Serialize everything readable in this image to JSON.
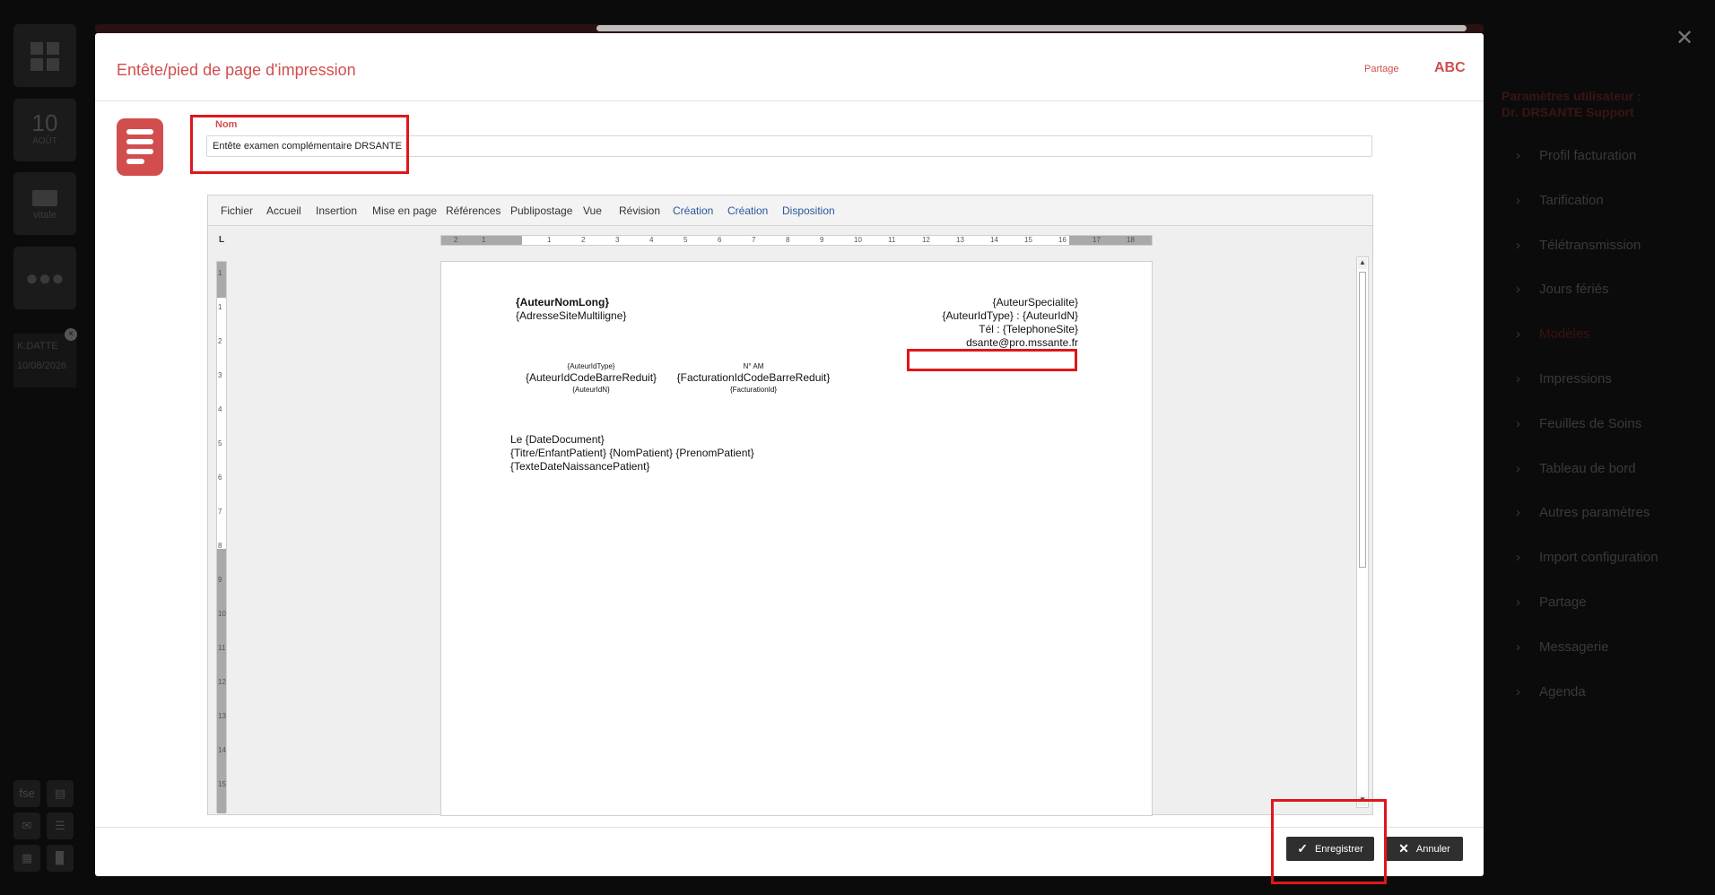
{
  "modal": {
    "title": "Entête/pied de page d'impression",
    "partage": "Partage",
    "abc": "ABC",
    "name_label": "Nom",
    "name_value": "Entête examen complémentaire DRSANTE"
  },
  "ribbon": {
    "tabs": [
      "Fichier",
      "Accueil",
      "Insertion",
      "Mise en page",
      "Références",
      "Publipostage",
      "Vue",
      "Révision",
      "Création",
      "Création",
      "Disposition"
    ]
  },
  "ruler": {
    "corner": "L",
    "h_labels": [
      "2",
      "1",
      "1",
      "2",
      "3",
      "4",
      "5",
      "6",
      "7",
      "8",
      "9",
      "10",
      "11",
      "12",
      "13",
      "14",
      "15",
      "16",
      "17",
      "18"
    ],
    "v_labels": [
      "1",
      "1",
      "2",
      "3",
      "4",
      "5",
      "6",
      "7",
      "8",
      "9",
      "10",
      "11",
      "12",
      "13",
      "14",
      "15"
    ]
  },
  "document": {
    "author_name": "{AuteurNomLong}",
    "address": "{AdresseSiteMultiligne}",
    "specialty": "{AuteurSpecialite}",
    "id_line": "{AuteurIdType} : {AuteurIdN}",
    "tel": "Tél : {TelephoneSite}",
    "email": "dsante@pro.mssante.fr",
    "barcode1_top": "{AuteurIdType}",
    "barcode1_main": "{AuteurIdCodeBarreReduit}",
    "barcode1_bottom": "{AuteurIdN}",
    "barcode2_top": "N° AM",
    "barcode2_main": "{FacturationIdCodeBarreReduit}",
    "barcode2_bottom": "{FacturationId}",
    "date_line": "Le {DateDocument}",
    "patient_line": "{Titre/EnfantPatient} {NomPatient} {PrenomPatient}",
    "birth_line": "{TexteDateNaissancePatient}"
  },
  "buttons": {
    "save": "Enregistrer",
    "cancel": "Annuler"
  },
  "left_rail": {
    "day": "10",
    "month": "AOÛT",
    "vitale": "vitale",
    "patient_name": "K.DATTE",
    "patient_date": "10/08/2026",
    "fse": "fse"
  },
  "right_panel": {
    "title": "Paramètres utilisateur :",
    "subtitle": "Dr. DRSANTE Support",
    "items": [
      "Profil facturation",
      "Tarification",
      "Télétransmission",
      "Jours fériés",
      "Modèles",
      "Impressions",
      "Feuilles de Soins",
      "Tableau de bord",
      "Autres paramètres",
      "Import configuration",
      "Partage",
      "Messagerie",
      "Agenda"
    ]
  },
  "colors": {
    "accent": "#d24e4e",
    "highlight": "#e0161b",
    "button_dark": "#2f2f2f",
    "context_tab": "#2b579a"
  }
}
